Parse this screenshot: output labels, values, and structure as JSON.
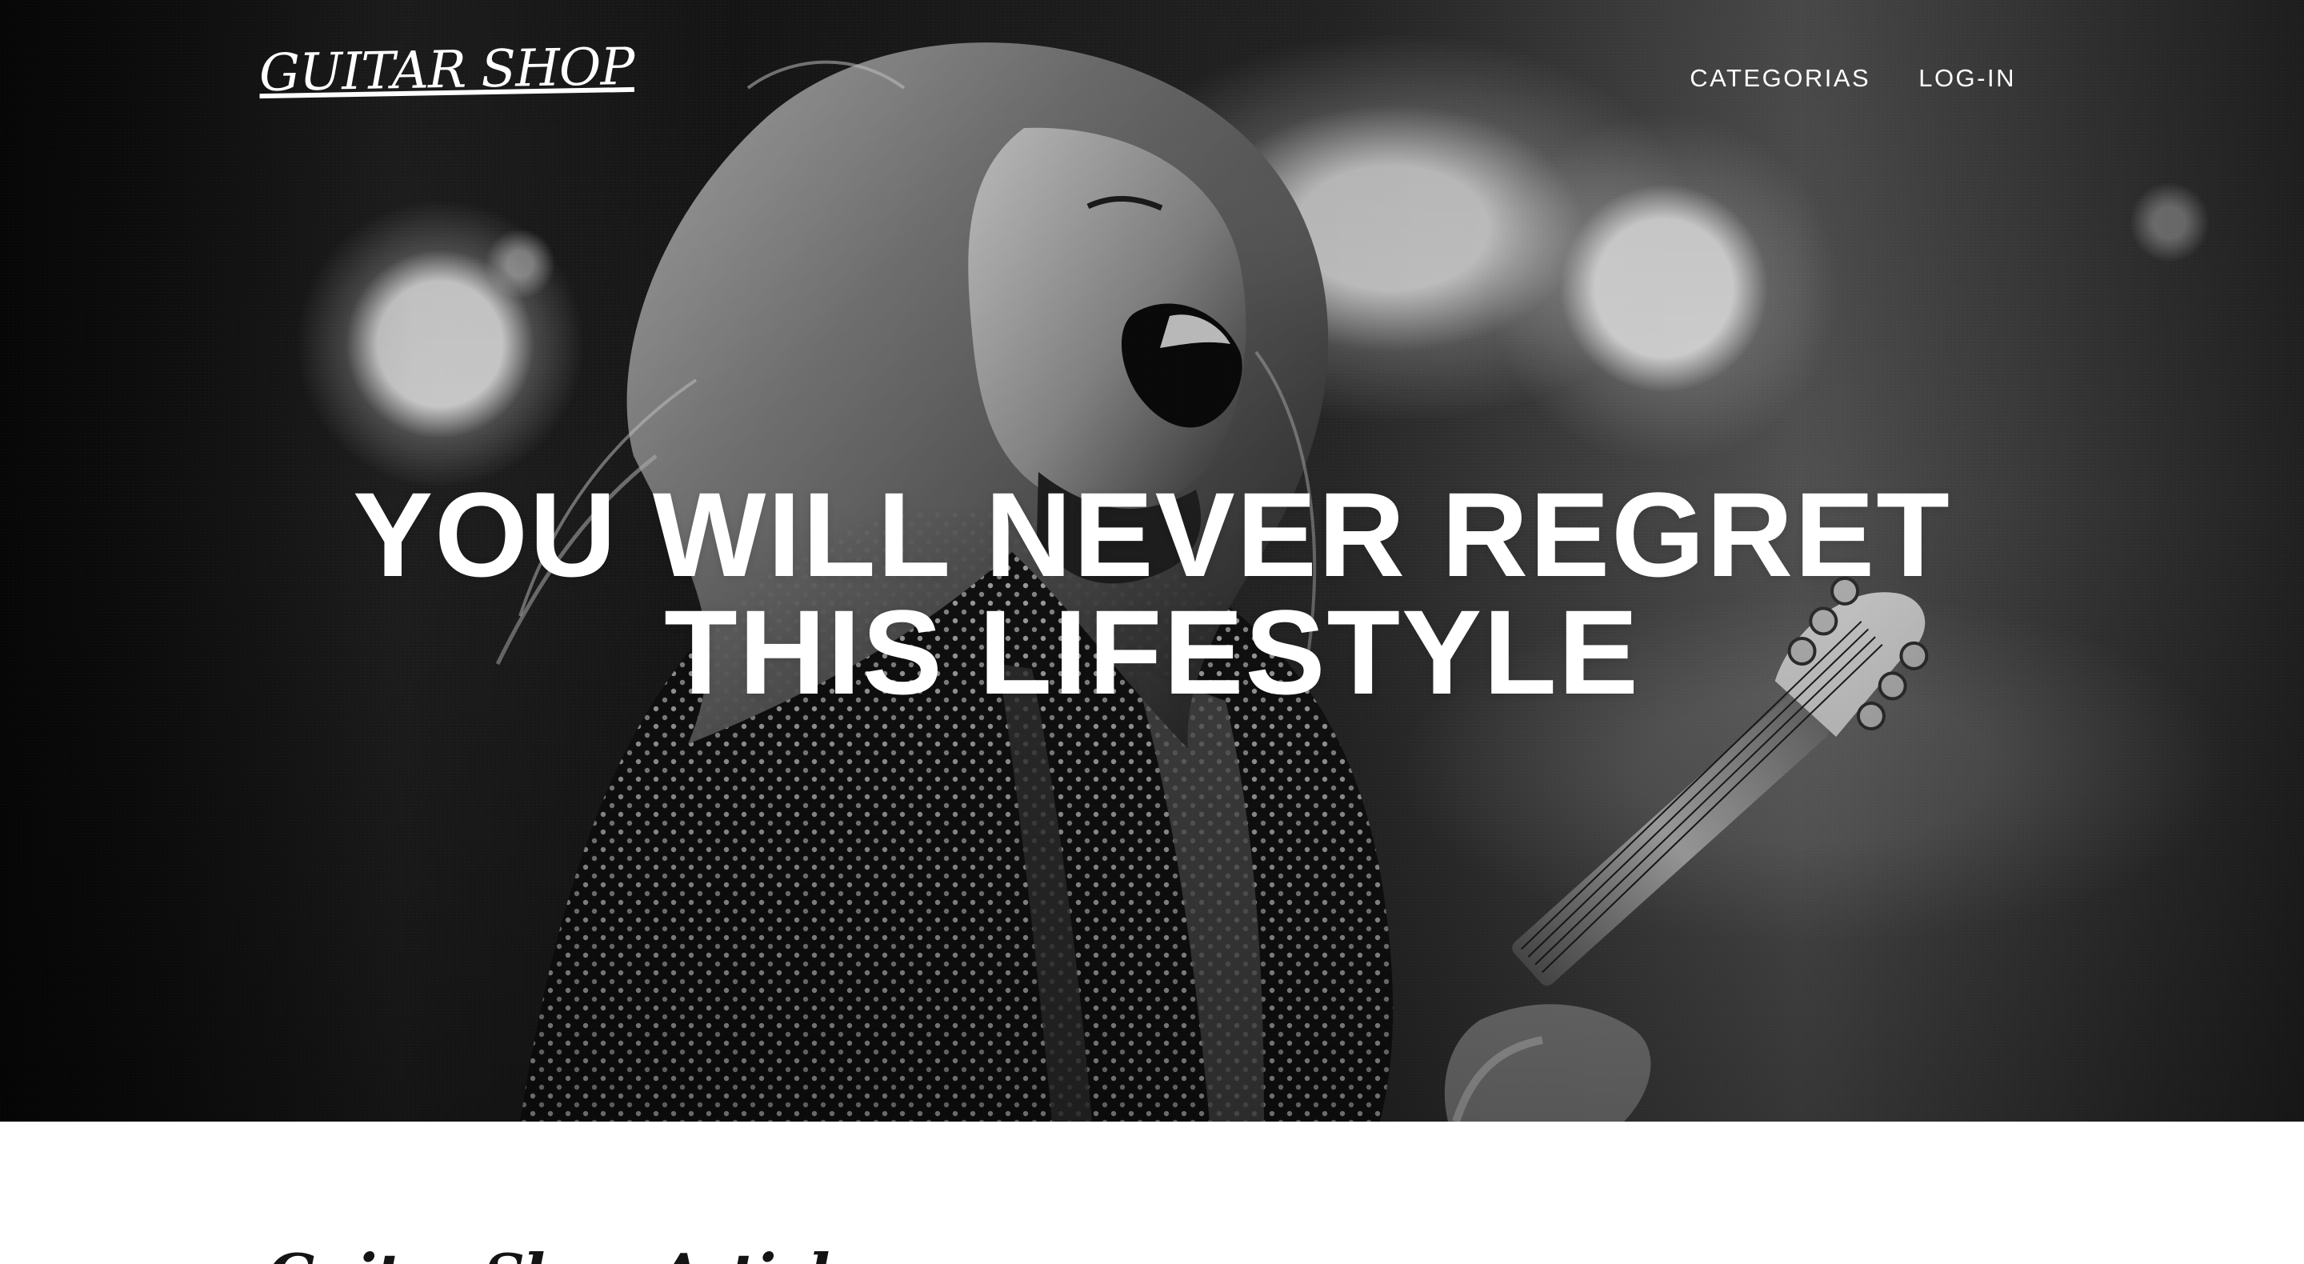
{
  "site": {
    "logo_text": "GUITAR SHOP"
  },
  "navigation": {
    "items": [
      {
        "label": "CATEGORIAS"
      },
      {
        "label": "LOG-IN"
      }
    ]
  },
  "hero": {
    "headline_line_1": "YOU WILL NEVER REGRET",
    "headline_line_2": "THIS LIFESTYLE",
    "image_alt": "Black and white photo of a long-haired guitarist shouting while playing a Fender guitar"
  },
  "next_section": {
    "heading": "Guitar Shop Articles"
  },
  "colors": {
    "nav_text": "#ffffff",
    "hero_text": "#ffffff",
    "page_background": "#ffffff"
  }
}
